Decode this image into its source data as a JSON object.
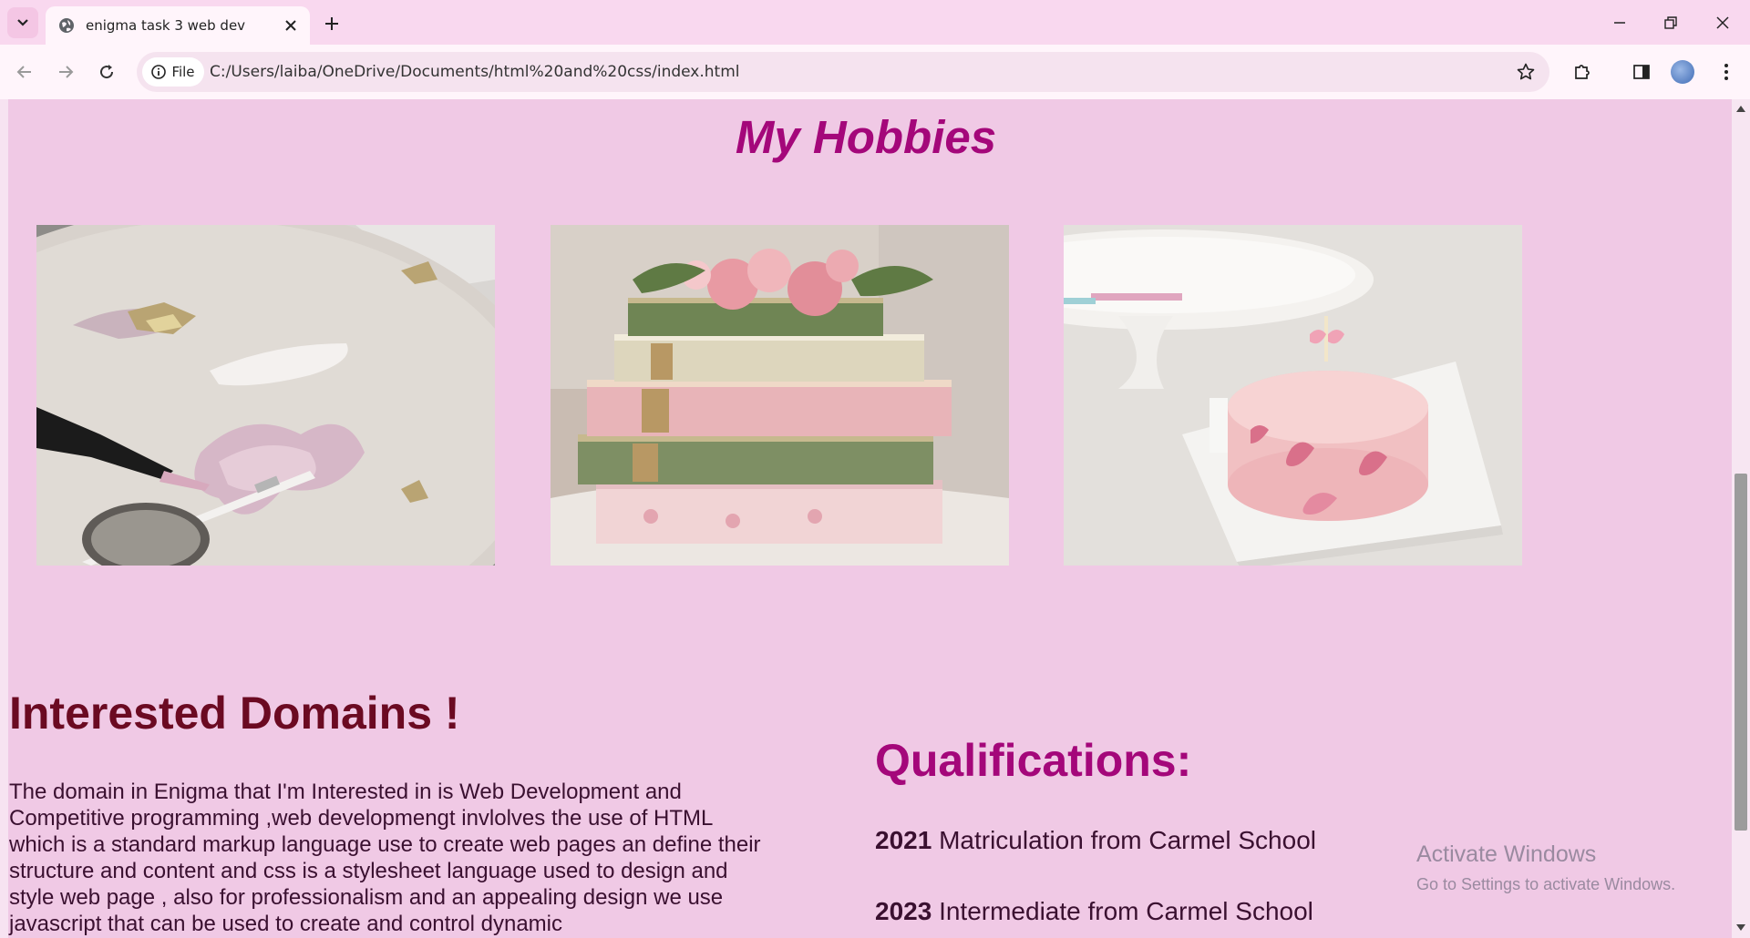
{
  "browser": {
    "tab_title": "enigma task 3 web dev",
    "site_chip": "File",
    "url": "C:/Users/laiba/OneDrive/Documents/html%20and%20css/index.html"
  },
  "page": {
    "hobbies_title": "My Hobbies",
    "hobbies": [
      {
        "name": "painting-hobby-image"
      },
      {
        "name": "books-hobby-image"
      },
      {
        "name": "baking-hobby-image"
      }
    ],
    "domains_title": "Interested Domains !",
    "domains_text": "The domain in Enigma that I'm Interested in is Web Development and Competitive programming ,web developmengt invlolves the use of HTML which is a standard markup language use to create web pages an define their structure and content and css is a stylesheet language used to design and style web page , also for professionalism and an appealing design we use javascript that can be used to create and control dynamic",
    "qualifications_title": "Qualifications:",
    "qualifications": [
      {
        "year": "2021",
        "text": " Matriculation from Carmel School"
      },
      {
        "year": "2023",
        "text": " Intermediate from Carmel School"
      }
    ]
  },
  "os_overlay": {
    "title": "Activate Windows",
    "subtitle": "Go to Settings to activate Windows."
  },
  "colors": {
    "page_background": "#f0c9e5",
    "heading_magenta": "#a4077a",
    "heading_maroon": "#6b0a22"
  }
}
